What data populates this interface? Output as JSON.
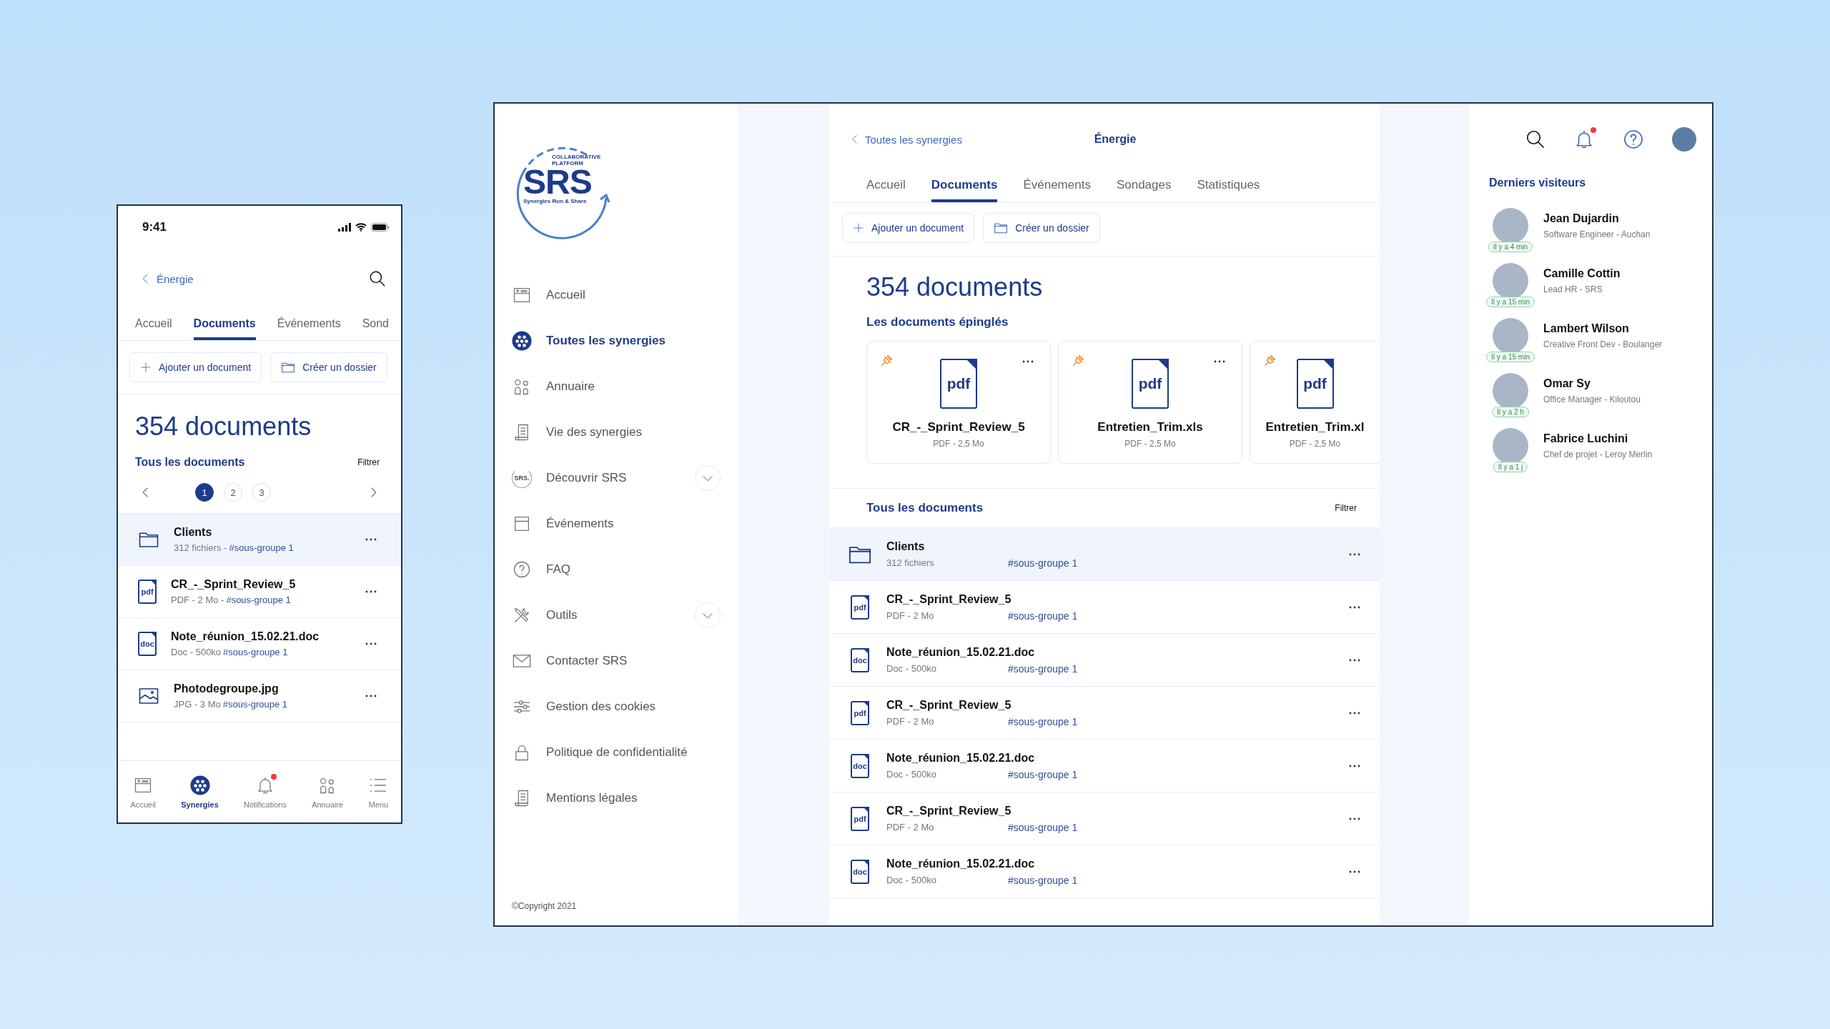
{
  "phone": {
    "status_bar": {
      "time": "9:41"
    },
    "back_label": "Énergie",
    "tabs": [
      {
        "label": "Accueil",
        "selected": false
      },
      {
        "label": "Documents",
        "selected": true
      },
      {
        "label": "Événements",
        "selected": false
      },
      {
        "label": "Sond",
        "selected": false
      }
    ],
    "actions": [
      {
        "kind": "add",
        "label": "Ajouter un document"
      },
      {
        "kind": "folder",
        "label": "Créer un dossier"
      }
    ],
    "count": "354 documents",
    "section_title": "Tous les documents",
    "filter": "Filtrer",
    "pages": [
      {
        "label": "1",
        "selected": true
      },
      {
        "label": "2",
        "selected": false
      },
      {
        "label": "3",
        "selected": false
      }
    ],
    "items": [
      {
        "kind": "folder",
        "name": "Clients",
        "meta": "312 fichiers -",
        "tag": "#sous-groupe 1",
        "selected": true
      },
      {
        "kind": "file",
        "icon_label": "pdf",
        "name": "CR_-_Sprint_Review_5",
        "meta": "PDF - 2 Mo -",
        "tag": "#sous-groupe 1",
        "selected": false
      },
      {
        "kind": "file",
        "icon_label": "doc",
        "name": "Note_réunion_15.02.21.doc",
        "meta": "Doc - 500ko",
        "tag": "#sous-groupe 1",
        "selected": false
      },
      {
        "kind": "image",
        "name": "Photodegroupe.jpg",
        "meta": "JPG - 3 Mo",
        "tag": "#sous-groupe 1",
        "selected": false
      }
    ],
    "nav": [
      {
        "kind": "home",
        "label": "Accueil",
        "selected": false,
        "unread": false
      },
      {
        "kind": "synergies",
        "label": "Synergies",
        "selected": true,
        "unread": false
      },
      {
        "kind": "bell",
        "label": "Notifications",
        "selected": false,
        "unread": true
      },
      {
        "kind": "directory",
        "label": "Annuaire",
        "selected": false,
        "unread": false
      },
      {
        "kind": "menu",
        "label": "Menu",
        "selected": false,
        "unread": false
      }
    ]
  },
  "desktop": {
    "sidebar": {
      "logo": {
        "tagline": "COLLABORATIVE PLATFORM",
        "name": "SRS",
        "subtitle": "Synergies Run & Share"
      },
      "items": [
        {
          "kind": "home",
          "label": "Accueil",
          "selected": false,
          "expandable": false
        },
        {
          "kind": "synergies",
          "label": "Toutes les synergies",
          "selected": true,
          "expandable": false
        },
        {
          "kind": "directory",
          "label": "Annuaire",
          "selected": false,
          "expandable": false
        },
        {
          "kind": "journal",
          "label": "Vie des synergies",
          "selected": false,
          "expandable": false
        },
        {
          "kind": "discover",
          "icon_label": "SRS.",
          "label": "Découvrir SRS",
          "selected": false,
          "expandable": true
        },
        {
          "kind": "calendar",
          "label": "Événements",
          "selected": false,
          "expandable": false
        },
        {
          "kind": "faq",
          "label": "FAQ",
          "selected": false,
          "expandable": false
        },
        {
          "kind": "tools",
          "label": "Outils",
          "selected": false,
          "expandable": true
        },
        {
          "kind": "mail",
          "label": "Contacter SRS",
          "selected": false,
          "expandable": false
        },
        {
          "kind": "cookies",
          "label": "Gestion des cookies",
          "selected": false,
          "expandable": false
        },
        {
          "kind": "lock",
          "label": "Politique de confidentialité",
          "selected": false,
          "expandable": false
        },
        {
          "kind": "journal",
          "label": "Mentions légales",
          "selected": false,
          "expandable": false
        }
      ],
      "copyright": "©Copyright 2021"
    },
    "header": {
      "back_label": "Toutes les synergies",
      "title": "Énergie"
    },
    "tabs": [
      {
        "label": "Accueil",
        "selected": false
      },
      {
        "label": "Documents",
        "selected": true
      },
      {
        "label": "Événements",
        "selected": false
      },
      {
        "label": "Sondages",
        "selected": false
      },
      {
        "label": "Statistiques",
        "selected": false
      }
    ],
    "actions": [
      {
        "kind": "add",
        "label": "Ajouter un document"
      },
      {
        "kind": "folder",
        "label": "Créer un dossier"
      }
    ],
    "count": "354 documents",
    "pinned_title": "Les documents épinglés",
    "pinned": [
      {
        "icon_label": "pdf",
        "name": "CR_-_Sprint_Review_5",
        "meta": "PDF - 2,5 Mo",
        "menu": true
      },
      {
        "icon_label": "pdf",
        "name": "Entretien_Trim.xls",
        "meta": "PDF - 2,5 Mo",
        "menu": true
      },
      {
        "icon_label": "pdf",
        "name": "Entretien_Trim.xl",
        "meta": "PDF - 2,5 Mo",
        "menu": false
      }
    ],
    "section_title": "Tous les documents",
    "filter": "Filtrer",
    "items": [
      {
        "kind": "folder",
        "name": "Clients",
        "meta": "312 fichiers",
        "tag": "#sous-groupe 1",
        "selected": true
      },
      {
        "kind": "file",
        "icon_label": "pdf",
        "name": "CR_-_Sprint_Review_5",
        "meta": "PDF - 2 Mo",
        "tag": "#sous-groupe 1",
        "selected": false
      },
      {
        "kind": "file",
        "icon_label": "doc",
        "name": "Note_réunion_15.02.21.doc",
        "meta": "Doc - 500ko",
        "tag": "#sous-groupe 1",
        "selected": false
      },
      {
        "kind": "file",
        "icon_label": "pdf",
        "name": "CR_-_Sprint_Review_5",
        "meta": "PDF - 2 Mo",
        "tag": "#sous-groupe 1",
        "selected": false
      },
      {
        "kind": "file",
        "icon_label": "doc",
        "name": "Note_réunion_15.02.21.doc",
        "meta": "Doc - 500ko",
        "tag": "#sous-groupe 1",
        "selected": false
      },
      {
        "kind": "file",
        "icon_label": "pdf",
        "name": "CR_-_Sprint_Review_5",
        "meta": "PDF - 2 Mo",
        "tag": "#sous-groupe 1",
        "selected": false
      },
      {
        "kind": "file",
        "icon_label": "doc",
        "name": "Note_réunion_15.02.21.doc",
        "meta": "Doc - 500ko",
        "tag": "#sous-groupe 1",
        "selected": false
      }
    ],
    "toolbar": {
      "notifications_unread": true
    },
    "visitors_title": "Derniers visiteurs",
    "visitors": [
      {
        "name": "Jean Dujardin",
        "role": "Software Engineer - Auchan",
        "time": "Il y a 4 min"
      },
      {
        "name": "Camille Cottin",
        "role": "Lead HR - SRS",
        "time": "Il y a 15 min"
      },
      {
        "name": "Lambert Wilson",
        "role": "Creative Front Dev - Boulanger",
        "time": "Il y a 15 min"
      },
      {
        "name": "Omar Sy",
        "role": "Office Manager - Kiloutou",
        "time": "Il y a 2 h"
      },
      {
        "name": "Fabrice Luchini",
        "role": "Chef de projet - Leroy Merlin",
        "time": "Il y a 1 j"
      }
    ]
  }
}
